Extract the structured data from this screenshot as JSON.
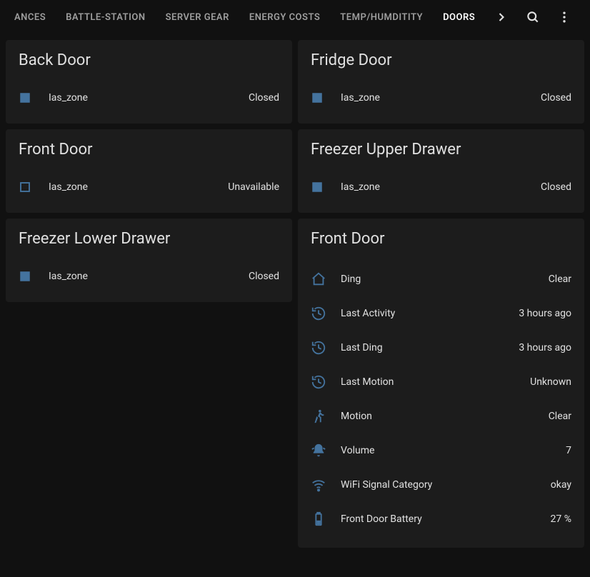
{
  "tabs": [
    {
      "label": "ANCES",
      "active": false
    },
    {
      "label": "BATTLE-STATION",
      "active": false
    },
    {
      "label": "SERVER GEAR",
      "active": false
    },
    {
      "label": "ENERGY COSTS",
      "active": false
    },
    {
      "label": "TEMP/HUMDITITY",
      "active": false
    },
    {
      "label": "DOORS",
      "active": true
    }
  ],
  "cards": {
    "back_door": {
      "title": "Back Door",
      "sensor_label": "Ias_zone",
      "status": "Closed",
      "icon": "square-filled"
    },
    "fridge_door": {
      "title": "Fridge Door",
      "sensor_label": "Ias_zone",
      "status": "Closed",
      "icon": "square-filled"
    },
    "front_door_simple": {
      "title": "Front Door",
      "sensor_label": "Ias_zone",
      "status": "Unavailable",
      "icon": "square-outline"
    },
    "freezer_upper": {
      "title": "Freezer Upper Drawer",
      "sensor_label": "Ias_zone",
      "status": "Closed",
      "icon": "square-filled"
    },
    "freezer_lower": {
      "title": "Freezer Lower Drawer",
      "sensor_label": "Ias_zone",
      "status": "Closed",
      "icon": "square-filled"
    },
    "front_door_detail": {
      "title": "Front Door",
      "rows": [
        {
          "icon": "home",
          "label": "Ding",
          "value": "Clear"
        },
        {
          "icon": "history",
          "label": "Last Activity",
          "value": "3 hours ago"
        },
        {
          "icon": "history",
          "label": "Last Ding",
          "value": "3 hours ago"
        },
        {
          "icon": "history",
          "label": "Last Motion",
          "value": "Unknown"
        },
        {
          "icon": "motion",
          "label": "Motion",
          "value": "Clear"
        },
        {
          "icon": "bell",
          "label": "Volume",
          "value": "7"
        },
        {
          "icon": "wifi",
          "label": "WiFi Signal Category",
          "value": "okay"
        },
        {
          "icon": "battery",
          "label": "Front Door Battery",
          "value": "27 %"
        }
      ]
    }
  }
}
